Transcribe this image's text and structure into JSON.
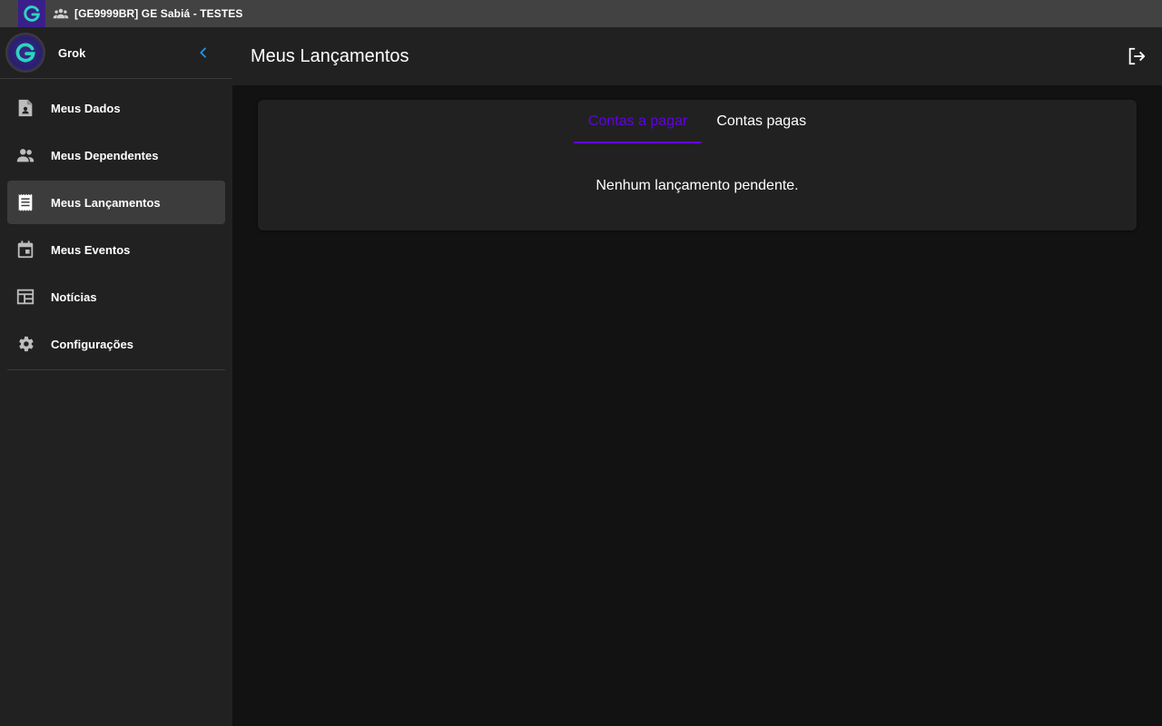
{
  "app": {
    "group_title": "[GE9999BR] GE Sabiá - TESTES",
    "accent_color": "#6200ea",
    "logo_colors": [
      "#14b8a6",
      "#3a1f8a"
    ]
  },
  "sidebar": {
    "user_name": "Grok",
    "items": [
      {
        "label": "Meus Dados",
        "icon": "account-file-icon",
        "active": false
      },
      {
        "label": "Meus Dependentes",
        "icon": "people-icon",
        "active": false
      },
      {
        "label": "Meus Lançamentos",
        "icon": "receipt-icon",
        "active": true
      },
      {
        "label": "Meus Eventos",
        "icon": "calendar-icon",
        "active": false
      },
      {
        "label": "Notícias",
        "icon": "newspaper-icon",
        "active": false
      },
      {
        "label": "Configurações",
        "icon": "gear-icon",
        "active": false
      }
    ]
  },
  "header": {
    "title": "Meus Lançamentos"
  },
  "card": {
    "tabs": [
      {
        "label": "Contas a pagar",
        "active": true
      },
      {
        "label": "Contas pagas",
        "active": false
      }
    ],
    "empty_message": "Nenhum lançamento pendente."
  }
}
